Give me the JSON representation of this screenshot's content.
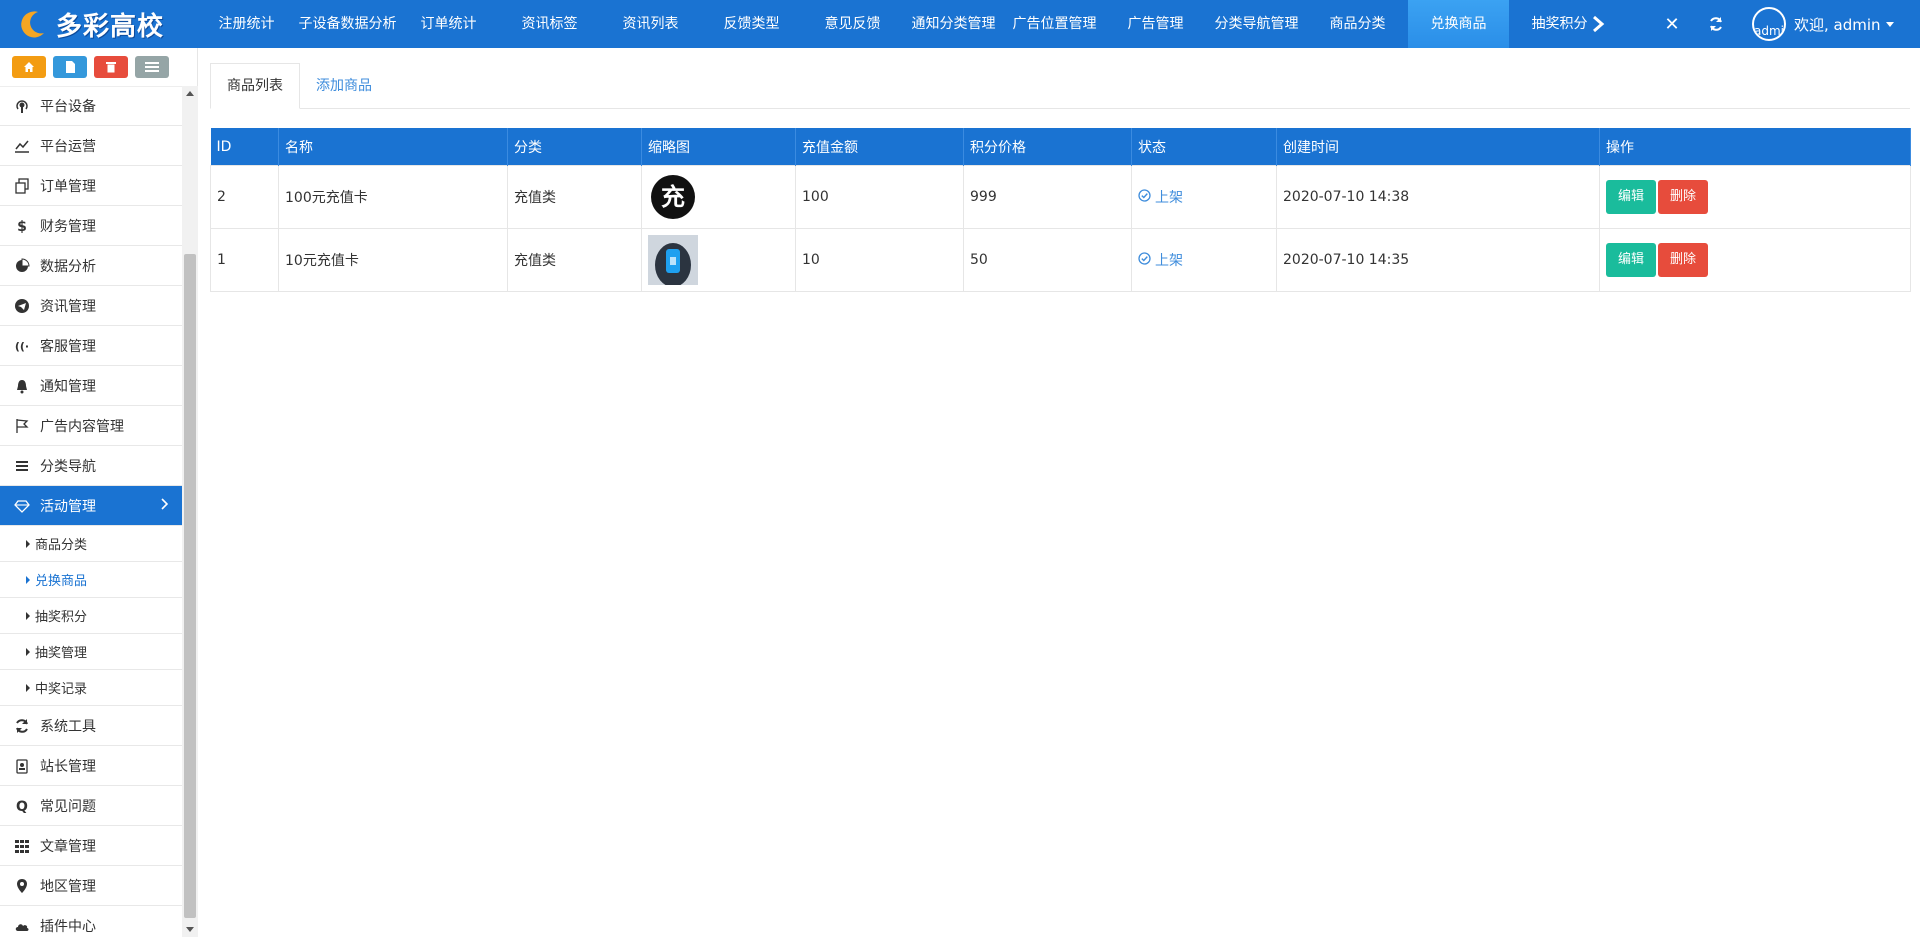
{
  "app": {
    "logo_text": "多彩高校"
  },
  "topnav": [
    {
      "label": "注册统计"
    },
    {
      "label": "子设备数据分析"
    },
    {
      "label": "订单统计"
    },
    {
      "label": "资讯标签"
    },
    {
      "label": "资讯列表"
    },
    {
      "label": "反馈类型"
    },
    {
      "label": "意见反馈"
    },
    {
      "label": "通知分类管理"
    },
    {
      "label": "广告位置管理"
    },
    {
      "label": "广告管理"
    },
    {
      "label": "分类导航管理"
    },
    {
      "label": "商品分类"
    },
    {
      "label": "兑换商品"
    },
    {
      "label": "抽奖积分"
    }
  ],
  "topnav_active_index": 12,
  "user": {
    "avatar_alt": "admin",
    "greeting": "欢迎, admin"
  },
  "sidebar": {
    "menu": [
      {
        "label": "平台设备",
        "icon": "podcast-icon"
      },
      {
        "label": "平台运营",
        "icon": "line-chart-icon"
      },
      {
        "label": "订单管理",
        "icon": "copy-icon"
      },
      {
        "label": "财务管理",
        "icon": "dollar-icon"
      },
      {
        "label": "数据分析",
        "icon": "pie-chart-icon"
      },
      {
        "label": "资讯管理",
        "icon": "telegram-icon"
      },
      {
        "label": "客服管理",
        "icon": "volume-icon"
      },
      {
        "label": "通知管理",
        "icon": "bell-icon"
      },
      {
        "label": "广告内容管理",
        "icon": "flag-icon"
      },
      {
        "label": "分类导航",
        "icon": "bars-icon"
      },
      {
        "label": "活动管理",
        "icon": "diamond-icon",
        "active": true
      }
    ],
    "submenu": [
      {
        "label": "商品分类"
      },
      {
        "label": "兑换商品",
        "active": true
      },
      {
        "label": "抽奖积分"
      },
      {
        "label": "抽奖管理"
      },
      {
        "label": "中奖记录"
      }
    ],
    "menu_after": [
      {
        "label": "系统工具",
        "icon": "refresh-icon"
      },
      {
        "label": "站长管理",
        "icon": "badge-icon"
      },
      {
        "label": "常见问题",
        "icon": "q-icon"
      },
      {
        "label": "文章管理",
        "icon": "grid-icon"
      },
      {
        "label": "地区管理",
        "icon": "map-marker-icon"
      },
      {
        "label": "插件中心",
        "icon": "cloud-icon"
      }
    ]
  },
  "tabs": [
    {
      "label": "商品列表",
      "active": true
    },
    {
      "label": "添加商品"
    }
  ],
  "table": {
    "columns": [
      "ID",
      "名称",
      "分类",
      "缩略图",
      "充值金额",
      "积分价格",
      "状态",
      "创建时间",
      "操作"
    ],
    "rows": [
      {
        "id": "2",
        "name": "100元充值卡",
        "category": "充值类",
        "thumb_text": "充",
        "amount": "100",
        "points": "999",
        "status": "上架",
        "created": "2020-07-10 14:38"
      },
      {
        "id": "1",
        "name": "10元充值卡",
        "category": "充值类",
        "thumb_text": "",
        "amount": "10",
        "points": "50",
        "status": "上架",
        "created": "2020-07-10 14:35"
      }
    ],
    "edit_label": "编辑",
    "delete_label": "删除"
  },
  "colors": {
    "primary": "#1a73d2",
    "active_nav": "#2a8ee8",
    "edit": "#1abc9c",
    "delete": "#e74c3c",
    "link": "#3f8ddc"
  }
}
